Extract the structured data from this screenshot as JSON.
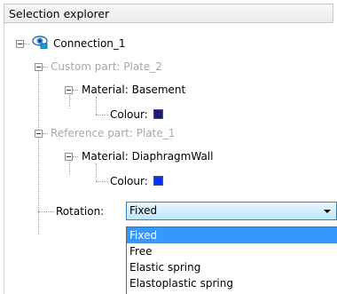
{
  "header": {
    "title": "Selection explorer"
  },
  "tree": {
    "connection": {
      "label": "Connection_1"
    },
    "custom_part": {
      "label": "Custom part: Plate_2"
    },
    "custom_material": {
      "label": "Material: Basement"
    },
    "custom_colour": {
      "label": "Colour:",
      "color": "#1a1a7a"
    },
    "reference_part": {
      "label": "Reference part: Plate_1"
    },
    "reference_material": {
      "label": "Material: DiaphragmWall"
    },
    "reference_colour": {
      "label": "Colour:",
      "color": "#0033ff"
    },
    "rotation": {
      "label": "Rotation:",
      "value": "Fixed"
    }
  },
  "dropdown": {
    "options": [
      "Fixed",
      "Free",
      "Elastic spring",
      "Elastoplastic spring"
    ],
    "selected": "Fixed"
  },
  "colors": {
    "selection": "#3399ff",
    "combo_border": "#3c7fb1"
  },
  "icons": {
    "connection": "eye-icon",
    "expander": "collapse-minus-icon"
  }
}
